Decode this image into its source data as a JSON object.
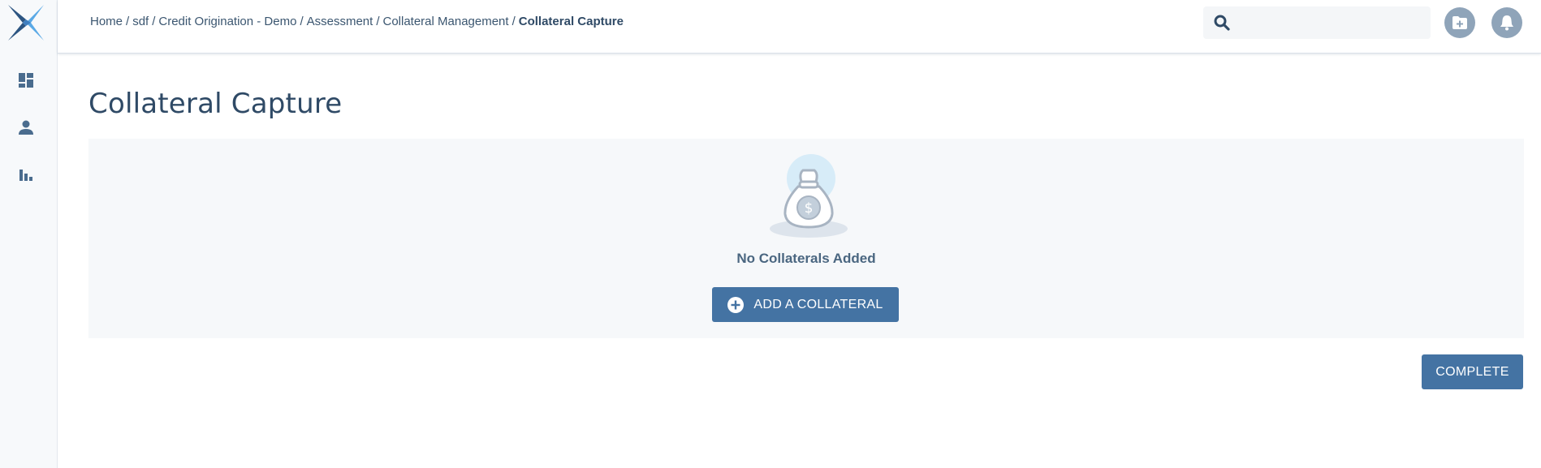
{
  "sidebar": {
    "logo": "x-logo",
    "items": [
      {
        "icon": "dashboard-icon"
      },
      {
        "icon": "person-icon"
      },
      {
        "icon": "bar-chart-icon"
      }
    ]
  },
  "header": {
    "breadcrumb": [
      {
        "label": "Home"
      },
      {
        "label": "sdf"
      },
      {
        "label": "Credit Origination - Demo"
      },
      {
        "label": "Assessment"
      },
      {
        "label": "Collateral Management"
      },
      {
        "label": "Collateral Capture"
      }
    ],
    "breadcrumb_separator": "/",
    "search": {
      "placeholder": "",
      "value": ""
    },
    "actions": [
      {
        "icon": "add-folder-icon"
      },
      {
        "icon": "bell-icon"
      }
    ]
  },
  "main": {
    "title": "Collateral Capture",
    "empty_state": {
      "illustration": "money-bag-icon",
      "message": "No Collaterals Added",
      "add_button_label": "ADD A COLLATERAL"
    },
    "complete_button_label": "COMPLETE"
  },
  "colors": {
    "primary": "#4473a3",
    "text": "#2f4a66",
    "panel_bg": "#f6f8fa",
    "logo_dark": "#2c5582",
    "logo_light": "#5aa9e6"
  }
}
